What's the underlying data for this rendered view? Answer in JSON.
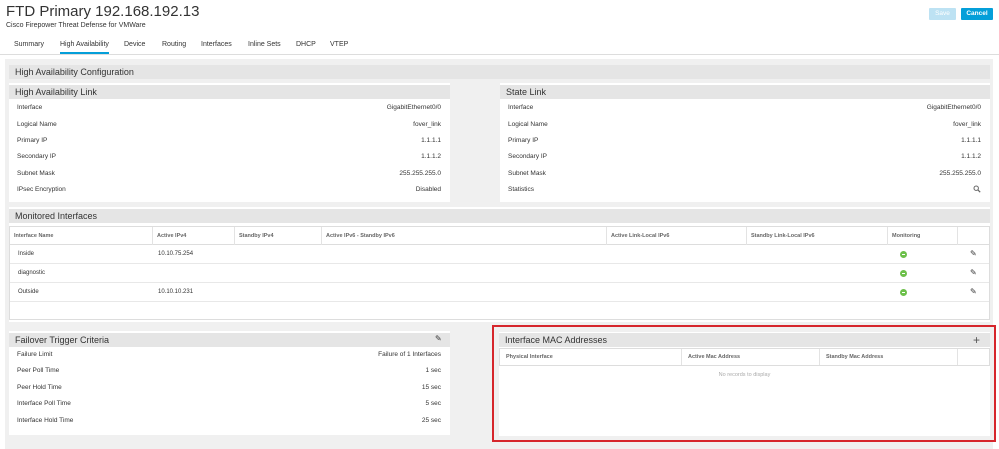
{
  "header": {
    "title": "FTD Primary 192.168.192.13",
    "subtitle": "Cisco Firepower Threat Defense for VMWare",
    "save_label": "Save",
    "cancel_label": "Cancel"
  },
  "tabs": [
    {
      "label": "Summary",
      "active": false
    },
    {
      "label": "High Availability",
      "active": true
    },
    {
      "label": "Device",
      "active": false
    },
    {
      "label": "Routing",
      "active": false
    },
    {
      "label": "Interfaces",
      "active": false
    },
    {
      "label": "Inline Sets",
      "active": false
    },
    {
      "label": "DHCP",
      "active": false
    },
    {
      "label": "VTEP",
      "active": false
    }
  ],
  "ha_config": {
    "title": "High Availability Configuration",
    "ha_link": {
      "title": "High Availability Link",
      "rows": [
        {
          "label": "Interface",
          "value": "GigabitEthernet0/0"
        },
        {
          "label": "Logical Name",
          "value": "fover_link"
        },
        {
          "label": "Primary IP",
          "value": "1.1.1.1"
        },
        {
          "label": "Secondary IP",
          "value": "1.1.1.2"
        },
        {
          "label": "Subnet Mask",
          "value": "255.255.255.0"
        },
        {
          "label": "IPsec Encryption",
          "value": "Disabled"
        }
      ]
    },
    "state_link": {
      "title": "State Link",
      "rows": [
        {
          "label": "Interface",
          "value": "GigabitEthernet0/0"
        },
        {
          "label": "Logical Name",
          "value": "fover_link"
        },
        {
          "label": "Primary IP",
          "value": "1.1.1.1"
        },
        {
          "label": "Secondary IP",
          "value": "1.1.1.2"
        },
        {
          "label": "Subnet Mask",
          "value": "255.255.255.0"
        },
        {
          "label": "Statistics",
          "value": ""
        }
      ]
    }
  },
  "monitored": {
    "title": "Monitored Interfaces",
    "columns": [
      "Interface Name",
      "Active IPv4",
      "Standby IPv4",
      "Active IPv6 - Standby IPv6",
      "Active Link-Local IPv6",
      "Standby Link-Local IPv6",
      "Monitoring"
    ],
    "rows": [
      {
        "name": "Inside",
        "active_ipv4": "10.10.75.254"
      },
      {
        "name": "diagnostic",
        "active_ipv4": ""
      },
      {
        "name": "Outside",
        "active_ipv4": "10.10.10.231"
      }
    ]
  },
  "failover": {
    "title": "Failover Trigger Criteria",
    "rows": [
      {
        "label": "Failure Limit",
        "value": "Failure of 1 Interfaces"
      },
      {
        "label": "Peer Poll Time",
        "value": "1 sec"
      },
      {
        "label": "Peer Hold Time",
        "value": "15 sec"
      },
      {
        "label": "Interface Poll Time",
        "value": "5 sec"
      },
      {
        "label": "Interface Hold Time",
        "value": "25 sec"
      }
    ]
  },
  "mac": {
    "title": "Interface MAC Addresses",
    "columns": [
      "Physical Interface",
      "Active Mac Address",
      "Standby Mac Address"
    ],
    "empty_text": "No records to display"
  },
  "colors": {
    "accent": "#049fd9",
    "highlight_border": "#d6262c",
    "status_ok": "#6cc04a"
  }
}
